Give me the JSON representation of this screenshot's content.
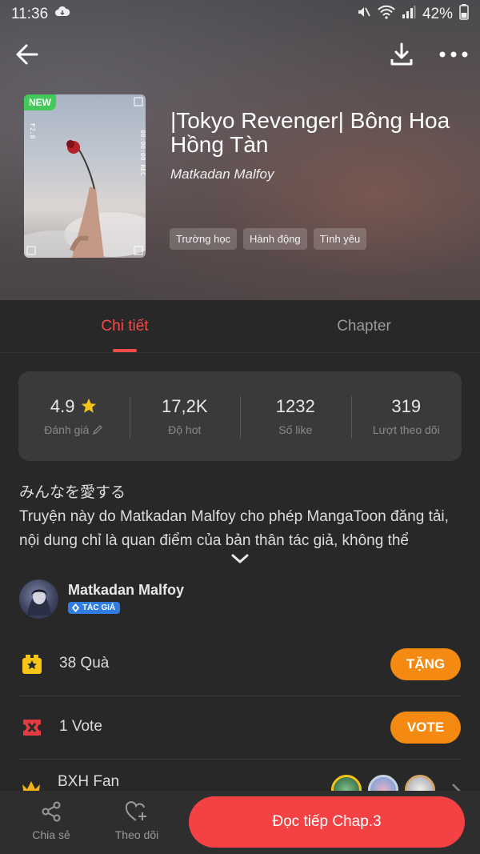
{
  "status_bar": {
    "time": "11:36",
    "battery": "42%"
  },
  "comic": {
    "badge": "NEW",
    "title": "|Tokyo Revenger| Bông Hoa Hồng Tàn",
    "author": "Matkadan Malfoy",
    "tags": [
      "Trường học",
      "Hành động",
      "Tình yêu"
    ]
  },
  "tabs": {
    "details": "Chi tiết",
    "chapter": "Chapter"
  },
  "stats": [
    {
      "value": "4.9",
      "label": "Đánh giá"
    },
    {
      "value": "17,2K",
      "label": "Độ hot"
    },
    {
      "value": "1232",
      "label": "Số like"
    },
    {
      "value": "319",
      "label": "Lượt theo dõi"
    }
  ],
  "description": {
    "line1": "みんなを愛する",
    "line2": "Truyện này do Matkadan Malfoy cho phép MangaToon đăng tải, nội dung chỉ là quan điểm của bản thân tác giả, không thể"
  },
  "author_row": {
    "name": "Matkadan Malfoy",
    "badge": "TÁC GIẢ"
  },
  "gifts": {
    "label": "38 Quà",
    "button": "TẶNG"
  },
  "votes": {
    "label": "1 Vote",
    "button": "VOTE"
  },
  "fans": {
    "label": "BXH Fan"
  },
  "bottom": {
    "share": "Chia sẻ",
    "follow": "Theo dõi",
    "read": "Đọc tiếp Chap.3"
  },
  "colors": {
    "accent_red": "#f44a4a",
    "orange": "#f58a12",
    "new_badge": "#42c95a",
    "author_badge": "#2f7de0"
  }
}
